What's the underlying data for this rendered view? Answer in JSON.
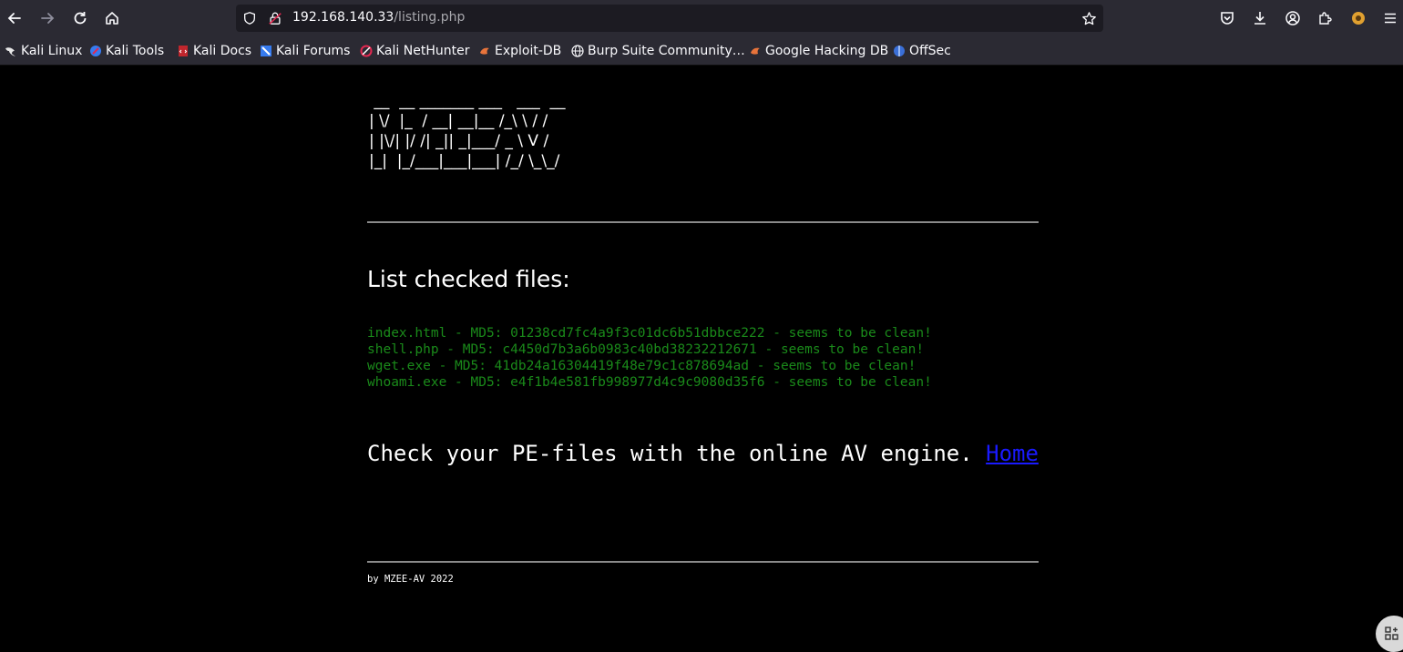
{
  "browser": {
    "url_host": "192.168.140.33",
    "url_path": "/listing.php",
    "bookmarks": [
      {
        "label": "Kali Linux",
        "icon": "kali-dragon-icon"
      },
      {
        "label": "Kali Tools",
        "icon": "kali-tools-icon"
      },
      {
        "label": "Kali Docs",
        "icon": "kali-docs-icon"
      },
      {
        "label": "Kali Forums",
        "icon": "kali-forums-icon"
      },
      {
        "label": "Kali NetHunter",
        "icon": "nethunter-icon"
      },
      {
        "label": "Exploit-DB",
        "icon": "exploit-db-icon"
      },
      {
        "label": "Burp Suite Community…",
        "icon": "globe-icon"
      },
      {
        "label": "Google Hacking DB",
        "icon": "exploit-db-icon"
      },
      {
        "label": "OffSec",
        "icon": "offsec-icon"
      }
    ]
  },
  "page": {
    "ascii_art": " __  __ _______ ___   ___  __\n| \\/  |_  / __| __|__ /_\\ \\ / /\n| |\\/| |/ /| _|| _|___/ _ \\ V /\n|_|  |_/___|___|___| /_/ \\_\\_/",
    "list_title": "List checked files:",
    "files": [
      "index.html - MD5: 01238cd7fc4a9f3c01dc6b51dbbce222 - seems to be clean!",
      "shell.php - MD5: c4450d7b3a6b0983c40bd38232212671 - seems to be clean!",
      "wget.exe - MD5: 41db24a16304419f48e79c1c878694ad - seems to be clean!",
      "whoami.exe - MD5: e4f1b4e581fb998977d4c9c9080d35f6 - seems to be clean!"
    ],
    "check_text": "Check your PE-files with the online AV engine. ",
    "home_link": "Home",
    "footer": "by MZEE-AV 2022"
  },
  "colors": {
    "file_text": "#1a8a1a",
    "link": "#1a1aff",
    "chrome_bg": "#2b2a33",
    "page_bg": "#000000"
  }
}
